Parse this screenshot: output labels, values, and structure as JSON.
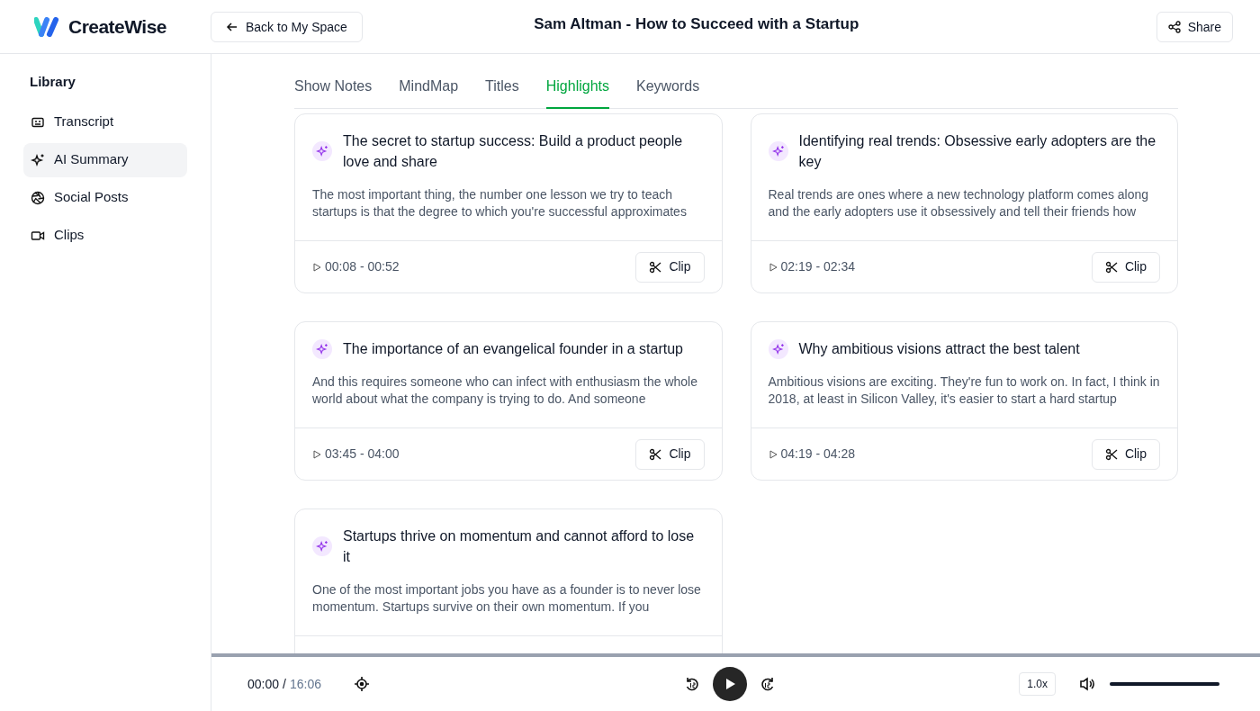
{
  "app": {
    "name": "CreateWise"
  },
  "header": {
    "back_button": "Back to My Space",
    "title": "Sam Altman - How to Succeed with a Startup",
    "share_button": "Share"
  },
  "sidebar": {
    "heading": "Library",
    "items": [
      {
        "label": "Transcript",
        "kind": "transcript",
        "selected": false
      },
      {
        "label": "AI Summary",
        "kind": "sparkle",
        "selected": true
      },
      {
        "label": "Social Posts",
        "kind": "aperture",
        "selected": false
      },
      {
        "label": "Clips",
        "kind": "video",
        "selected": false
      }
    ]
  },
  "tabs": [
    {
      "label": "Show Notes",
      "selected": false
    },
    {
      "label": "MindMap",
      "selected": false
    },
    {
      "label": "Titles",
      "selected": false
    },
    {
      "label": "Highlights",
      "selected": true
    },
    {
      "label": "Keywords",
      "selected": false
    }
  ],
  "highlights": [
    {
      "title": "The secret to startup success: Build a product people love and share",
      "excerpt": "The most important thing, the number one lesson we try to teach startups is that the degree to which you're successful approximates",
      "time": "00:08 - 00:52",
      "clip_button": "Clip"
    },
    {
      "title": "Identifying real trends: Obsessive early adopters are the key",
      "excerpt": "Real trends are ones where a new technology platform comes along and the early adopters use it obsessively and tell their friends how",
      "time": "02:19 - 02:34",
      "clip_button": "Clip"
    },
    {
      "title": "The importance of an evangelical founder in a startup",
      "excerpt": "And this requires someone who can infect with enthusiasm the whole world about what the company is trying to do. And someone",
      "time": "03:45 - 04:00",
      "clip_button": "Clip"
    },
    {
      "title": "Why ambitious visions attract the best talent",
      "excerpt": "Ambitious visions are exciting. They're fun to work on. In fact, I think in 2018, at least in Silicon Valley, it's easier to start a hard startup",
      "time": "04:19 - 04:28",
      "clip_button": "Clip"
    },
    {
      "title": "Startups thrive on momentum and cannot afford to lose it",
      "excerpt": "One of the most important jobs you have as a founder is to never lose momentum. Startups survive on their own momentum. If you"
    }
  ],
  "player": {
    "progress": {
      "level": 0
    },
    "current_time": "00:00",
    "separator": "/",
    "duration": "16:06",
    "speed": "1.0x",
    "volume": {
      "level": 1
    }
  }
}
